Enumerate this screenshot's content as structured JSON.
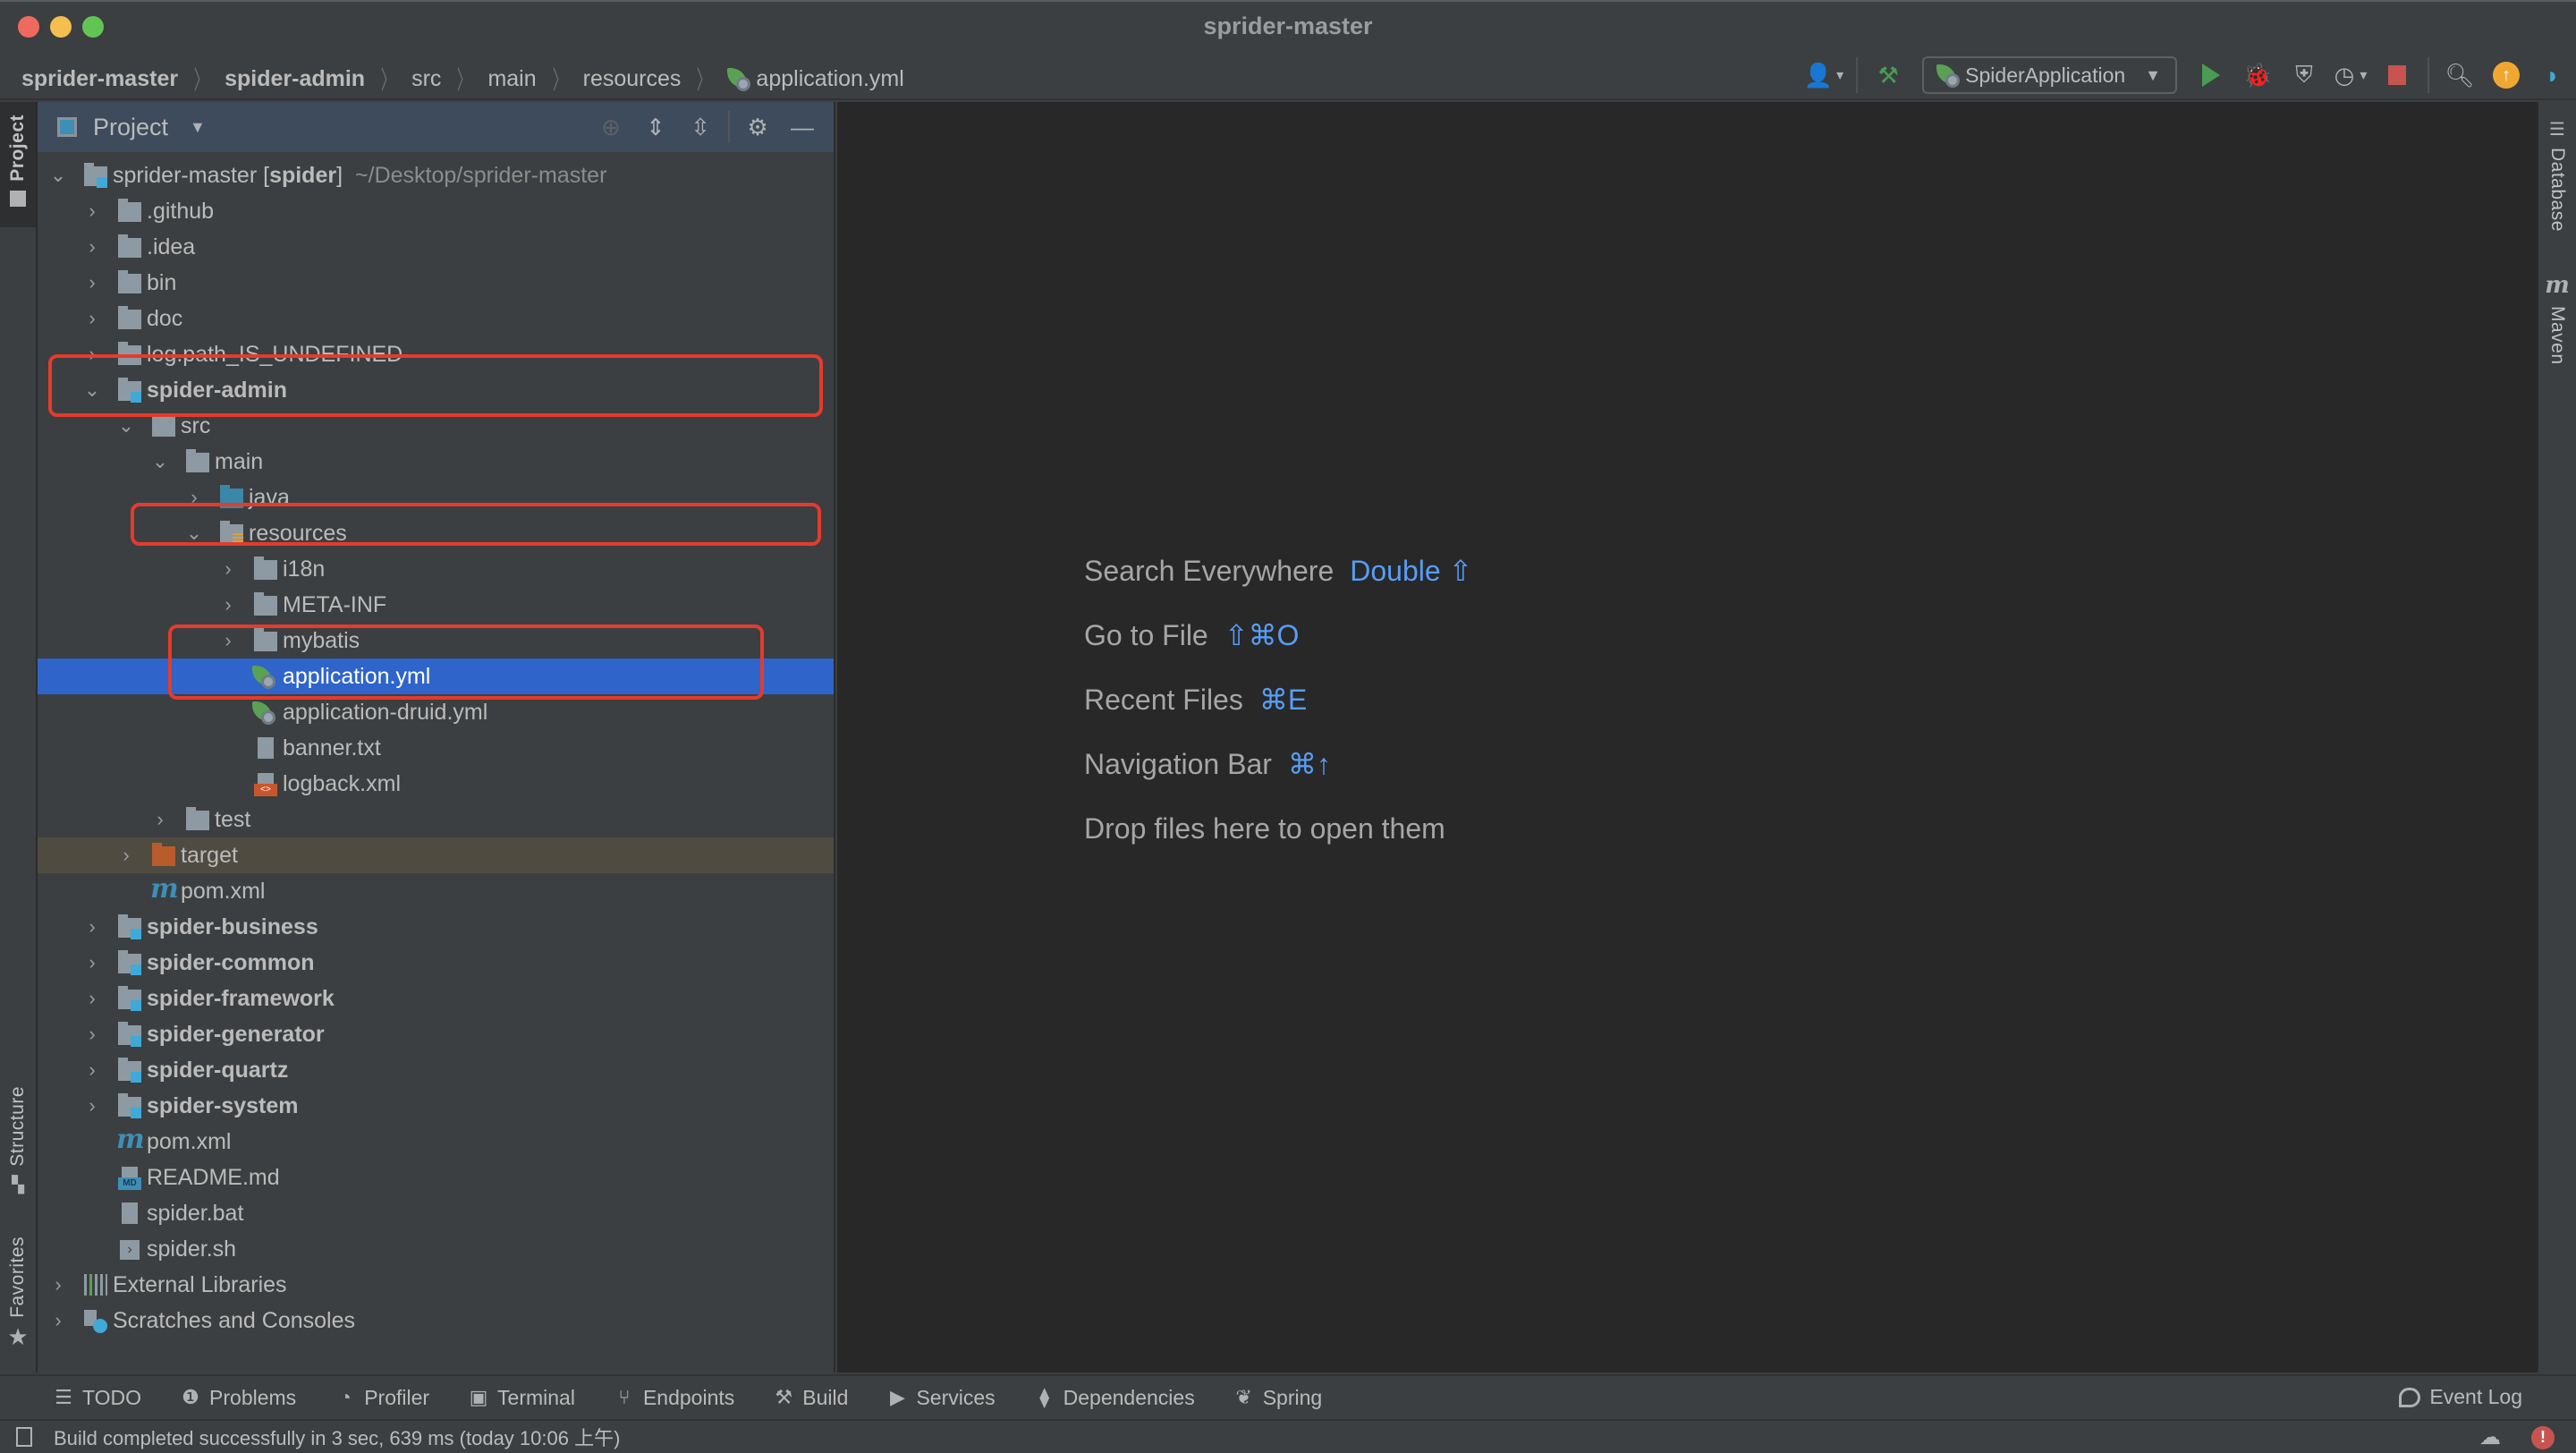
{
  "window": {
    "title": "sprider-master"
  },
  "breadcrumbs": [
    {
      "label": "sprider-master",
      "bold": true
    },
    {
      "label": "spider-admin",
      "bold": true
    },
    {
      "label": "src",
      "bold": false
    },
    {
      "label": "main",
      "bold": false
    },
    {
      "label": "resources",
      "bold": false
    },
    {
      "label": "application.yml",
      "bold": false,
      "icon": "spring-config-icon"
    }
  ],
  "toolbar": {
    "run_config": "SpiderApplication",
    "buttons": [
      "account-icon",
      "build-hammer-icon",
      "run-icon",
      "debug-icon",
      "coverage-icon",
      "profile-icon",
      "stop-icon",
      "search-icon",
      "update-icon",
      "code-with-me-icon"
    ]
  },
  "left_stripe": {
    "project": "Project",
    "structure": "Structure",
    "favorites": "Favorites"
  },
  "right_stripe": {
    "database": "Database",
    "maven": "Maven"
  },
  "project_panel": {
    "title": "Project",
    "root": {
      "name": "sprider-master",
      "module": "spider",
      "path": "~/Desktop/sprider-master"
    },
    "tree": [
      {
        "label": ".github",
        "depth": 1,
        "type": "folder",
        "expand": "collapsed"
      },
      {
        "label": ".idea",
        "depth": 1,
        "type": "folder",
        "expand": "collapsed"
      },
      {
        "label": "bin",
        "depth": 1,
        "type": "folder",
        "expand": "collapsed"
      },
      {
        "label": "doc",
        "depth": 1,
        "type": "folder",
        "expand": "collapsed"
      },
      {
        "label": "log.path_IS_UNDEFINED",
        "depth": 1,
        "type": "folder",
        "expand": "collapsed"
      },
      {
        "label": "spider-admin",
        "depth": 1,
        "type": "module",
        "expand": "expanded",
        "bold": true
      },
      {
        "label": "src",
        "depth": 2,
        "type": "folder",
        "expand": "expanded"
      },
      {
        "label": "main",
        "depth": 3,
        "type": "folder",
        "expand": "expanded"
      },
      {
        "label": "java",
        "depth": 4,
        "type": "source-folder",
        "expand": "collapsed"
      },
      {
        "label": "resources",
        "depth": 4,
        "type": "resources-folder",
        "expand": "expanded"
      },
      {
        "label": "i18n",
        "depth": 5,
        "type": "folder",
        "expand": "collapsed"
      },
      {
        "label": "META-INF",
        "depth": 5,
        "type": "folder",
        "expand": "collapsed"
      },
      {
        "label": "mybatis",
        "depth": 5,
        "type": "folder",
        "expand": "collapsed"
      },
      {
        "label": "application.yml",
        "depth": 5,
        "type": "spring-yml",
        "expand": "none",
        "selected": true
      },
      {
        "label": "application-druid.yml",
        "depth": 5,
        "type": "spring-yml",
        "expand": "none"
      },
      {
        "label": "banner.txt",
        "depth": 5,
        "type": "text-file",
        "expand": "none"
      },
      {
        "label": "logback.xml",
        "depth": 5,
        "type": "xml-file",
        "expand": "none"
      },
      {
        "label": "test",
        "depth": 3,
        "type": "folder",
        "expand": "collapsed"
      },
      {
        "label": "target",
        "depth": 2,
        "type": "excluded-folder",
        "expand": "collapsed",
        "excluded": true
      },
      {
        "label": "pom.xml",
        "depth": 2,
        "type": "maven",
        "expand": "none"
      },
      {
        "label": "spider-business",
        "depth": 1,
        "type": "module",
        "expand": "collapsed",
        "bold": true
      },
      {
        "label": "spider-common",
        "depth": 1,
        "type": "module",
        "expand": "collapsed",
        "bold": true
      },
      {
        "label": "spider-framework",
        "depth": 1,
        "type": "module",
        "expand": "collapsed",
        "bold": true
      },
      {
        "label": "spider-generator",
        "depth": 1,
        "type": "module",
        "expand": "collapsed",
        "bold": true
      },
      {
        "label": "spider-quartz",
        "depth": 1,
        "type": "module",
        "expand": "collapsed",
        "bold": true
      },
      {
        "label": "spider-system",
        "depth": 1,
        "type": "module",
        "expand": "collapsed",
        "bold": true
      },
      {
        "label": "pom.xml",
        "depth": 1,
        "type": "maven",
        "expand": "none"
      },
      {
        "label": "README.md",
        "depth": 1,
        "type": "markdown",
        "expand": "none"
      },
      {
        "label": "spider.bat",
        "depth": 1,
        "type": "text-file",
        "expand": "none"
      },
      {
        "label": "spider.sh",
        "depth": 1,
        "type": "shell",
        "expand": "none"
      },
      {
        "label": "External Libraries",
        "depth": 0,
        "type": "libraries",
        "expand": "collapsed"
      },
      {
        "label": "Scratches and Consoles",
        "depth": 0,
        "type": "scratches",
        "expand": "collapsed"
      }
    ],
    "annotations": [
      "spider-admin",
      "resources",
      "application.yml"
    ]
  },
  "editor": {
    "hints": [
      {
        "text": "Search Everywhere",
        "key": "Double ⇧"
      },
      {
        "text": "Go to File",
        "key": "⇧⌘O"
      },
      {
        "text": "Recent Files",
        "key": "⌘E"
      },
      {
        "text": "Navigation Bar",
        "key": "⌘↑"
      },
      {
        "text": "Drop files here to open them",
        "key": ""
      }
    ]
  },
  "bottom_tools": [
    {
      "label": "TODO",
      "icon": "todo-list-icon"
    },
    {
      "label": "Problems",
      "icon": "problems-icon"
    },
    {
      "label": "Profiler",
      "icon": "profiler-icon"
    },
    {
      "label": "Terminal",
      "icon": "terminal-icon"
    },
    {
      "label": "Endpoints",
      "icon": "endpoints-icon"
    },
    {
      "label": "Build",
      "icon": "build-hammer-icon"
    },
    {
      "label": "Services",
      "icon": "services-icon"
    },
    {
      "label": "Dependencies",
      "icon": "dependencies-icon"
    },
    {
      "label": "Spring",
      "icon": "spring-leaf-icon"
    }
  ],
  "event_log": "Event Log",
  "status": {
    "message": "Build completed successfully in 3 sec, 639 ms (today 10:06 上午)"
  },
  "colors": {
    "selection": "#2f65ca",
    "annotation": "#e53b2c",
    "shortcut": "#589df6",
    "module_badge": "#3fa9d8"
  }
}
